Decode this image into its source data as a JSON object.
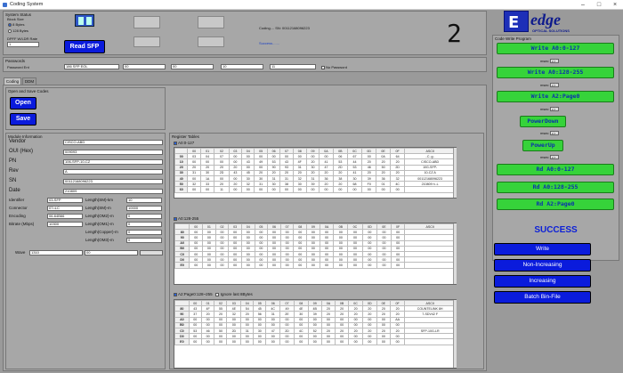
{
  "window": {
    "title": "Coding System"
  },
  "system_status": {
    "label": "System Status",
    "block_size_label": "Block Size",
    "block_opts": [
      "8 Bytes",
      "128 Bytes"
    ],
    "speed_label": "DPFF W/LDR Rate",
    "speed_value": "1",
    "read_button": "Read SFP",
    "status_text": "Coding.... SN: 00112168096223",
    "success_text": "Success.......",
    "digit": "2"
  },
  "passwords": {
    "label": "Passwords",
    "pwd_label": "Password Ent",
    "pwd_type": "186 SFP EOL",
    "fields": [
      "00",
      "00",
      "10",
      "11"
    ],
    "no_pwd_label": "No Password"
  },
  "tabs": [
    "Coding",
    "DDM"
  ],
  "open_save": {
    "label": "Open and Save Codes",
    "open": "Open",
    "save": "Save"
  },
  "module_info": {
    "label": "Module Information",
    "fields": [
      {
        "label": "Vendor",
        "value": "CISCO-ABD"
      },
      {
        "label": "OUI (Hex)",
        "value": "009093"
      },
      {
        "label": "PN",
        "value": "106-SFP-10-CZ"
      },
      {
        "label": "Rev",
        "value": "A"
      },
      {
        "label": "SN",
        "value": "00112168096223"
      },
      {
        "label": "Date",
        "value": "210809"
      }
    ],
    "small": [
      {
        "label": "Identifier",
        "value": "03-SFP"
      },
      {
        "label": "Connector",
        "value": "07=LC"
      },
      {
        "label": "Encoding",
        "value": "06-64B66"
      },
      {
        "label": "Bitrate (Mbps)",
        "value": "10300"
      }
    ],
    "lengths": [
      {
        "label": "Length(SM)-km",
        "value": "10"
      },
      {
        "label": "Length(SM)-m",
        "value": "10000"
      },
      {
        "label": "Length(OM2)-m",
        "value": "0"
      },
      {
        "label": "Length(OM1)-m",
        "value": "0"
      },
      {
        "label": "Length(Copper)-m",
        "value": "0"
      },
      {
        "label": "Length(OM3)-m",
        "value": "0"
      }
    ],
    "wave_label": "Wave",
    "wave_value": "1310",
    "wave_value2": "00"
  },
  "register_tables": {
    "label": "Register Tables",
    "t1_label": "A0:0-127",
    "t2_label": "A0:128-255",
    "t3_label": "A2:Page0:128~255",
    "t3_check2": "Ignore last 8Bytes",
    "cols": [
      "00",
      "01",
      "02",
      "03",
      "04",
      "05",
      "06",
      "07",
      "08",
      "09",
      "0A",
      "0B",
      "0C",
      "0D",
      "0E",
      "0F",
      "ASCII"
    ],
    "t1_rows": [
      {
        "h": "00",
        "c": [
          "03",
          "04",
          "07",
          "00",
          "00",
          "00",
          "00",
          "00",
          "00",
          "00",
          "00",
          "06",
          "67",
          "00",
          "0A",
          "64"
        ],
        "a": "..C..g.."
      },
      {
        "h": "10",
        "c": [
          "00",
          "00",
          "00",
          "00",
          "43",
          "49",
          "53",
          "43",
          "4F",
          "20",
          "41",
          "53",
          "44",
          "20",
          "20",
          "20"
        ],
        "a": "CISCO-ABD"
      },
      {
        "h": "20",
        "c": [
          "20",
          "20",
          "20",
          "20",
          "00",
          "00",
          "90",
          "93",
          "31",
          "30",
          "47",
          "2D",
          "53",
          "46",
          "50",
          "2D"
        ],
        "a": "10G-SFP-"
      },
      {
        "h": "30",
        "c": [
          "31",
          "30",
          "2D",
          "43",
          "45",
          "20",
          "20",
          "20",
          "20",
          "20",
          "20",
          "20",
          "41",
          "20",
          "20",
          "20"
        ],
        "a": "10-CZ  A"
      },
      {
        "h": "40",
        "c": [
          "00",
          "1A",
          "00",
          "00",
          "30",
          "30",
          "31",
          "31",
          "32",
          "31",
          "36",
          "38",
          "30",
          "39",
          "36",
          "32"
        ],
        "a": "00112168096223"
      },
      {
        "h": "50",
        "c": [
          "32",
          "33",
          "20",
          "20",
          "32",
          "31",
          "30",
          "38",
          "30",
          "39",
          "20",
          "20",
          "68",
          "F0",
          "01",
          "4C"
        ],
        "a": "210809 h..L"
      },
      {
        "h": "60",
        "c": [
          "00",
          "00",
          "11",
          "00",
          "00",
          "00",
          "00",
          "00",
          "00",
          "00",
          "00",
          "00",
          "00",
          "00",
          "00",
          "00"
        ],
        "a": ""
      }
    ],
    "t2_rows": [
      {
        "h": "80",
        "c": [
          "00",
          "00",
          "00",
          "00",
          "00",
          "00",
          "00",
          "00",
          "00",
          "00",
          "00",
          "00",
          "00",
          "00",
          "00",
          "00"
        ],
        "a": ""
      },
      {
        "h": "90",
        "c": [
          "00",
          "00",
          "00",
          "00",
          "00",
          "00",
          "00",
          "00",
          "00",
          "00",
          "00",
          "00",
          "00",
          "00",
          "00",
          "00"
        ],
        "a": ""
      },
      {
        "h": "A0",
        "c": [
          "00",
          "00",
          "00",
          "00",
          "00",
          "00",
          "00",
          "00",
          "00",
          "00",
          "00",
          "00",
          "00",
          "00",
          "00",
          "00"
        ],
        "a": ""
      },
      {
        "h": "B0",
        "c": [
          "00",
          "00",
          "00",
          "00",
          "00",
          "00",
          "00",
          "00",
          "00",
          "00",
          "00",
          "00",
          "00",
          "00",
          "00",
          "00"
        ],
        "a": ""
      },
      {
        "h": "C0",
        "c": [
          "00",
          "00",
          "00",
          "00",
          "00",
          "00",
          "00",
          "00",
          "00",
          "00",
          "00",
          "00",
          "00",
          "00",
          "00",
          "00"
        ],
        "a": ""
      },
      {
        "h": "D0",
        "c": [
          "00",
          "00",
          "00",
          "00",
          "00",
          "00",
          "00",
          "00",
          "00",
          "00",
          "00",
          "00",
          "00",
          "00",
          "00",
          "00"
        ],
        "a": ""
      },
      {
        "h": "E0",
        "c": [
          "00",
          "00",
          "00",
          "00",
          "00",
          "00",
          "00",
          "00",
          "00",
          "00",
          "00",
          "00",
          "00",
          "00",
          "00",
          "00"
        ],
        "a": ""
      }
    ],
    "t3_rows": [
      {
        "h": "80",
        "c": [
          "43",
          "4F",
          "55",
          "4E",
          "54",
          "45",
          "4C",
          "49",
          "4E",
          "4B",
          "20",
          "20",
          "20",
          "20",
          "20",
          "20"
        ],
        "a": "COUNTELINK 8H"
      },
      {
        "h": "90",
        "c": [
          "37",
          "20",
          "20",
          "32",
          "20",
          "56",
          "31",
          "2E",
          "30",
          "39",
          "20",
          "20",
          "20",
          "20",
          "20",
          "20"
        ],
        "a": "7-SDV42 F"
      },
      {
        "h": "A0",
        "c": [
          "00",
          "00",
          "00",
          "00",
          "00",
          "00",
          "00",
          "00",
          "00",
          "00",
          "00",
          "00",
          "00",
          "00",
          "00",
          "AA"
        ],
        "a": ""
      },
      {
        "h": "B0",
        "c": [
          "00",
          "00",
          "00",
          "00",
          "00",
          "00",
          "00",
          "00",
          "00",
          "00",
          "00",
          "00",
          "00",
          "00",
          "00",
          "00"
        ],
        "a": ""
      },
      {
        "h": "C0",
        "c": [
          "53",
          "46",
          "50",
          "2D",
          "31",
          "30",
          "47",
          "2D",
          "4C",
          "52",
          "20",
          "20",
          "20",
          "20",
          "20",
          "20"
        ],
        "a": "SFP-10G-LR"
      },
      {
        "h": "D0",
        "c": [
          "00",
          "00",
          "00",
          "00",
          "00",
          "00",
          "00",
          "00",
          "00",
          "00",
          "00",
          "00",
          "00",
          "00",
          "00",
          "00"
        ],
        "a": ""
      },
      {
        "h": "E0",
        "c": [
          "00",
          "00",
          "00",
          "00",
          "00",
          "00",
          "00",
          "00",
          "00",
          "00",
          "00",
          "00",
          "00",
          "00",
          "00",
          "00"
        ],
        "a": ""
      }
    ]
  },
  "brand": {
    "logo_letter": "E",
    "name": "edge",
    "sub": "OPTICAL SOLUTIONS"
  },
  "code_mode": {
    "label": "Code Write Program",
    "buttons": [
      "Write A0:0-127",
      "Write A0:128-255",
      "Write A2:Page0",
      "PowerDown",
      "PowerUp",
      "Rd A0:0-127",
      "Rd A0:128-255",
      "Rd A2:Page0"
    ],
    "spin_label": "msec",
    "spin_value": "100",
    "success": "SUCCESS",
    "actions": [
      "Write",
      "Non-Increasing",
      "Increasing",
      "Batch Bin-File"
    ]
  }
}
